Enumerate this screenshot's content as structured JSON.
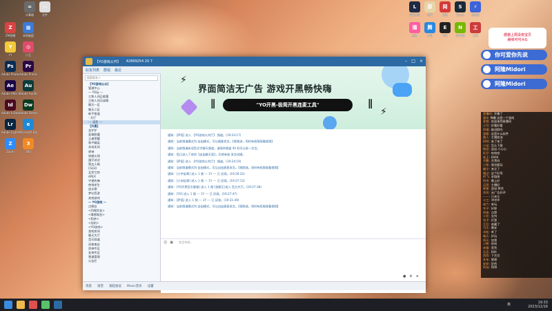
{
  "desktop": {
    "left_icons": [
      {
        "label": "计算器",
        "color": "#6b6b6b",
        "glyph": "="
      },
      {
        "label": "文件",
        "color": "#e0e0e0",
        "glyph": "▭"
      },
      {
        "label": "ZM直播",
        "color": "#d94444",
        "glyph": "Z"
      },
      {
        "label": "本地磁盘",
        "color": "#3b7bd8",
        "glyph": "▦"
      },
      {
        "label": "YY",
        "color": "#f3c93a",
        "glyph": "Y"
      },
      {
        "label": "小丑",
        "color": "#e04b6a",
        "glyph": "◎"
      },
      {
        "label": "Adobe Photoshop",
        "color": "#0a2d54",
        "glyph": "Ps"
      },
      {
        "label": "Adobe Premiere",
        "color": "#2a0845",
        "glyph": "Pr"
      },
      {
        "label": "Adobe After Effects",
        "color": "#1a0845",
        "glyph": "Ae"
      },
      {
        "label": "Adobe Audition",
        "color": "#0c3b3a",
        "glyph": "Au"
      },
      {
        "label": "Adobe InDesign",
        "color": "#4a0a1f",
        "glyph": "Id"
      },
      {
        "label": "Adobe Dreamweaver",
        "color": "#0a3a20",
        "glyph": "Dw"
      },
      {
        "label": "Adobe Lightroom",
        "color": "#0a2640",
        "glyph": "Lr"
      },
      {
        "label": "Microsoft Edge",
        "color": "#1d8ad8",
        "glyph": "e"
      },
      {
        "label": "Zoom",
        "color": "#2d8cff",
        "glyph": "Z"
      },
      {
        "label": "360",
        "color": "#f08a24",
        "glyph": "3"
      }
    ],
    "right_icons": [
      {
        "label": "英雄联盟",
        "color": "#1f2a44",
        "glyph": "L"
      },
      {
        "label": "原神",
        "color": "#e7d3a8",
        "glyph": "原"
      },
      {
        "label": "网易",
        "color": "#d43a3a",
        "glyph": "网"
      },
      {
        "label": "Steam",
        "color": "#1b2838",
        "glyph": "S"
      },
      {
        "label": "加速器",
        "color": "#3c63d8",
        "glyph": "⚡"
      },
      {
        "label": "直播",
        "color": "#ff5ea0",
        "glyph": "播"
      },
      {
        "label": "腾讯",
        "color": "#2a88e0",
        "glyph": "腾"
      },
      {
        "label": "EPIC",
        "color": "#222",
        "glyph": "E"
      },
      {
        "label": "NVIDIA",
        "color": "#76b900",
        "glyph": "N"
      },
      {
        "label": "工具",
        "color": "#cc3b3b",
        "glyph": "工"
      }
    ]
  },
  "window": {
    "title": "【YO游戏公开】",
    "meta": "42899254  20  7",
    "toolbar": [
      "好友列表",
      "群组",
      "最近"
    ],
    "search_placeholder": "搜索联系人",
    "sidebar_rows": [
      {
        "text": "【YO游戏公众】",
        "grp": true
      },
      {
        "text": "管理中心",
        "grp": false
      },
      {
        "text": "一 YO玩 一",
        "grp": false
      },
      {
        "text": "三和人间正能量",
        "grp": false
      },
      {
        "text": "三和人间兄弟情",
        "grp": false
      },
      {
        "text": "聊天一区",
        "grp": false
      },
      {
        "text": "聊天二区",
        "grp": false
      },
      {
        "text": "新手报道",
        "grp": false
      },
      {
        "text": "- 大厅",
        "grp": false
      },
      {
        "text": "--- 语音 ---",
        "grp": false,
        "sel": true
      },
      {
        "text": "【开黑】",
        "grp": true
      },
      {
        "text": "金铲铲",
        "grp": false
      },
      {
        "text": "英雄联盟",
        "grp": false
      },
      {
        "text": "王者荣耀",
        "grp": false
      },
      {
        "text": "和平精英",
        "grp": false
      },
      {
        "text": "永劫无间",
        "grp": false
      },
      {
        "text": "原神",
        "grp": false
      },
      {
        "text": "穿越火线",
        "grp": false
      },
      {
        "text": "蛋仔派对",
        "grp": false
      },
      {
        "text": "第五人格",
        "grp": false
      },
      {
        "text": "CSGO",
        "grp": false
      },
      {
        "text": "瓦罗兰特",
        "grp": false
      },
      {
        "text": "APEX",
        "grp": false
      },
      {
        "text": "守望先锋",
        "grp": false
      },
      {
        "text": "绝地求生",
        "grp": false
      },
      {
        "text": "逆水寒",
        "grp": false
      },
      {
        "text": "梦幻西游",
        "grp": false
      },
      {
        "text": "其他游戏",
        "grp": false
      },
      {
        "text": "一 YO游戏 一",
        "grp": true
      },
      {
        "text": "点歌台",
        "grp": false
      },
      {
        "text": "<同城交友>",
        "grp": false
      },
      {
        "text": "<情感电台>",
        "grp": false
      },
      {
        "text": "<相亲>",
        "grp": false
      },
      {
        "text": "<挂机>",
        "grp": false
      },
      {
        "text": "<YO游戏>",
        "grp": false
      },
      {
        "text": "游戏房间",
        "grp": false
      },
      {
        "text": "聊天大厅",
        "grp": false
      },
      {
        "text": "音乐频道",
        "grp": false
      },
      {
        "text": "深夜电台",
        "grp": false
      },
      {
        "text": "男神专区",
        "grp": false
      },
      {
        "text": "女神专区",
        "grp": false
      },
      {
        "text": "频道管理",
        "grp": false
      },
      {
        "text": "公告栏",
        "grp": false
      }
    ],
    "banner": {
      "title": "界面简洁无广告  游戏开黑畅快嗨",
      "pill": "\"YO开黑-极简开黑连麦工具\""
    },
    "messages": [
      {
        "sender": "通知:",
        "body": "[萨塔] 进入 【YO游戏公共厅】 频道。(19:24:17)"
      },
      {
        "sender": "通知:",
        "body": "当前频道模式为:自由模式，可以随意发言。【视频流，同时有权限观看视频】"
      },
      {
        "sender": "通知:",
        "body": "当前频道有语音文字聊天频道，请保持频道 40 秒可以发一次言。"
      },
      {
        "sender": "通知:",
        "body": "您已进入了房间【自由聊天室】，仍然有效 发言间隔。"
      },
      {
        "sender": "通知:",
        "body": "[萨塔] 进入 【YO游戏公共厅】 频道。(19:24:19)"
      },
      {
        "sender": "通知:",
        "body": "当前频道模式为:自由模式，可以自由麦麦发言。【视频流，同时有权限观看视频】"
      },
      {
        "sender": "通知:",
        "body": "[小宇宙哥] 进入 1 频   --- 1Y --- 已 厌烦。(19:26:22)"
      },
      {
        "sender": "通知:",
        "body": "[小米粒哥] 进入 1 频   --- 1Y --- 已 厌烦。(19:27:13)"
      },
      {
        "sender": "通知:",
        "body": "[YO开黑官方客服] 进入 1 频 [游客]已进入 官方大厅。(19:27:38)"
      },
      {
        "sender": "通知:",
        "body": "[YO] 进入 1 频   --- 1Y --- 已 厌烦。(19:27:47)"
      },
      {
        "sender": "通知:",
        "body": "[萨塔] 进入 1 频   --- 1Y --- 已 厌烦。(19:31:49)"
      },
      {
        "sender": "通知:",
        "body": "当前频道模式为:自由模式，可以自由麦麦发言。【视频流，同时有权限观看视频】"
      }
    ],
    "input_placeholder": "发言待发...",
    "footer": [
      "消息",
      "语音",
      "发起会议",
      "Music音乐",
      "设置"
    ]
  },
  "chat": {
    "head_line1": "感谢上周没有宝贝",
    "head_line2": "美味可可大G",
    "socials": [
      {
        "label": "你可爱你先说",
        "color": "#3c6bd4"
      },
      {
        "label": "阿隆Midori",
        "color": "#3c6bd4"
      },
      {
        "label": "阿隆Midori",
        "color": "#3c6bd4"
      }
    ],
    "lines": [
      {
        "name": "直播间:",
        "text": "开播了"
      },
      {
        "name": "爱吃",
        "text": "弹幕 这是一个游戏"
      },
      {
        "name": "老铁:",
        "text": "欢迎来到直播间"
      },
      {
        "name": "小可:",
        "text": "好看好看"
      },
      {
        "name": "阿晴:",
        "text": "能进群吗"
      },
      {
        "name": "游客:",
        "text": "这是什么软件"
      },
      {
        "name": "路人:",
        "text": "主播加油"
      },
      {
        "name": "阿明:",
        "text": "来了来了"
      },
      {
        "name": "小宝:",
        "text": "怎么下载"
      },
      {
        "name": "粉丝:",
        "text": "送出 小心心"
      },
      {
        "name": "旺仔:",
        "text": "哈哈哈"
      },
      {
        "name": "老王:",
        "text": "6666"
      },
      {
        "name": "大鹏:",
        "text": "开黑吗"
      },
      {
        "name": "小鱼:",
        "text": "我也要玩"
      },
      {
        "name": "橘子:",
        "text": "关注了"
      },
      {
        "name": "路过:",
        "text": "这个好用"
      },
      {
        "name": "阿飞:",
        "text": "求链接"
      },
      {
        "name": "阿杰:",
        "text": "晚上好"
      },
      {
        "name": "月亮:",
        "text": "主播好"
      },
      {
        "name": "星星:",
        "text": "送出 鲜花"
      },
      {
        "name": "凉风:",
        "text": "无广告好评"
      },
      {
        "name": "一一:",
        "text": "已关注"
      },
      {
        "name": "十三:",
        "text": "冲冲冲"
      },
      {
        "name": "老六:",
        "text": "来玩"
      },
      {
        "name": "木子:",
        "text": "好耶"
      },
      {
        "name": "阿南:",
        "text": "点赞"
      },
      {
        "name": "小北:",
        "text": "支持"
      },
      {
        "name": "包子:",
        "text": "厉害"
      },
      {
        "name": "豆豆:",
        "text": "收藏了"
      },
      {
        "name": "可乐:",
        "text": "晚安"
      },
      {
        "name": "米粒:",
        "text": "来了"
      },
      {
        "name": "晴天:",
        "text": "好玩"
      },
      {
        "name": "雨天:",
        "text": "加我"
      },
      {
        "name": "小熊:",
        "text": "哈哈"
      },
      {
        "name": "老猫:",
        "text": "签到"
      },
      {
        "name": "乐乐:",
        "text": "666"
      },
      {
        "name": "西西:",
        "text": "下次见"
      },
      {
        "name": "东东:",
        "text": "感谢"
      },
      {
        "name": "安安:",
        "text": "好的"
      },
      {
        "name": "阿灿:",
        "text": "拜拜"
      }
    ]
  },
  "taskbar": {
    "clock_time": "19:33",
    "clock_date": "2023/12/16",
    "lang": "英"
  }
}
